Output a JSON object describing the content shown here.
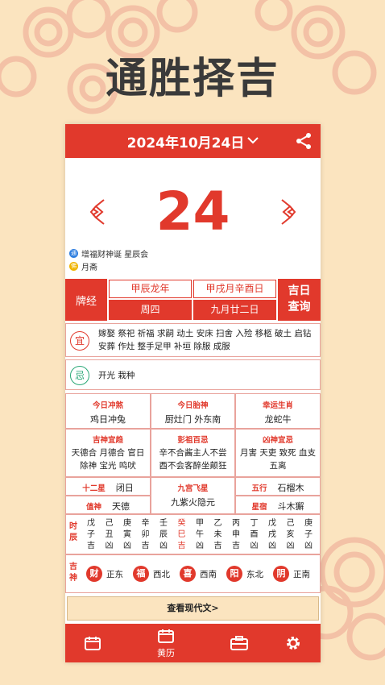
{
  "page_title": "通胜择吉",
  "header": {
    "date": "2024年10月24日",
    "dropdown_icon": "chevron-down-icon",
    "share_icon": "share-icon"
  },
  "day_number": "24",
  "festivals": [
    {
      "badge": "通",
      "badge_color": "#2f7fe0",
      "text": "增福财神诞 星辰会"
    },
    {
      "badge": "佛",
      "badge_color": "#f0b400",
      "text": "月斋"
    }
  ],
  "info": {
    "peijing": "牌经",
    "year_ganzhi": "甲辰龙年",
    "month_day_ganzhi": "甲戌月辛酉日",
    "weekday": "周四",
    "lunar_date": "九月廿二日",
    "jiri_button": [
      "吉日",
      "查询"
    ]
  },
  "yi": {
    "label": "宜",
    "text": "嫁娶 祭祀 祈福 求嗣 动土 安床 扫舍 入殓 移柩 破土 启钻 安葬 作灶 整手足甲 补垣 除服 成服"
  },
  "ji": {
    "label": "忌",
    "text": "开光 栽种"
  },
  "details": {
    "chongsha_label": "今日冲煞",
    "chongsha_value": "鸡日冲兔",
    "taishen_label": "今日胎神",
    "taishen_value": "厨灶门 外东南",
    "shengxiao_label": "幸运生肖",
    "shengxiao_value": "龙蛇牛",
    "jishen_label": "吉神宜趋",
    "jishen_value": "天德合 月德合 官日 除神 宝光 鸣吠",
    "pengzu_label": "彭祖百忌",
    "pengzu_value": "辛不合酱主人不尝 酉不会客醉坐颠狂",
    "xiongshen_label": "凶神宜忌",
    "xiongshen_value": "月害 天吏 致死 血支 五离",
    "jianchu_label": "十二星",
    "jianchu_value": "闭日",
    "zhishen_label": "值神",
    "zhishen_value": "天德",
    "jiugong_label": "九宫飞星",
    "jiugong_value": "九紫火隐元",
    "wuxing_label": "五行",
    "wuxing_value": "石榴木",
    "xingxiu_label": "星宿",
    "xingxiu_value": "斗木獬"
  },
  "hours": {
    "label": [
      "时",
      "辰"
    ],
    "cols": [
      [
        "戊",
        "子",
        "吉"
      ],
      [
        "己",
        "丑",
        "凶"
      ],
      [
        "庚",
        "寅",
        "凶"
      ],
      [
        "辛",
        "卯",
        "吉"
      ],
      [
        "壬",
        "辰",
        "凶"
      ],
      [
        "癸",
        "巳",
        "吉"
      ],
      [
        "甲",
        "午",
        "凶"
      ],
      [
        "乙",
        "未",
        "吉"
      ],
      [
        "丙",
        "申",
        "吉"
      ],
      [
        "丁",
        "酉",
        "凶"
      ],
      [
        "戊",
        "戌",
        "凶"
      ],
      [
        "己",
        "亥",
        "凶"
      ],
      [
        "庚",
        "子",
        "凶"
      ]
    ],
    "highlight_index": 5
  },
  "gods": {
    "label": [
      "吉",
      "神"
    ],
    "items": [
      {
        "badge": "财",
        "dir": "正东"
      },
      {
        "badge": "福",
        "dir": "西北"
      },
      {
        "badge": "喜",
        "dir": "西南"
      },
      {
        "badge": "阳",
        "dir": "东北"
      },
      {
        "badge": "阴",
        "dir": "正南"
      }
    ]
  },
  "modern_button": "查看现代文>",
  "nav": {
    "items": [
      {
        "icon": "calendar-icon",
        "label": ""
      },
      {
        "icon": "almanac-icon",
        "label": "黄历"
      },
      {
        "icon": "toolbox-icon",
        "label": ""
      },
      {
        "icon": "gear-icon",
        "label": ""
      }
    ]
  },
  "colors": {
    "primary_red": "#e1392c",
    "background": "#fbe4bf",
    "cloud": "#f5c9a6"
  }
}
